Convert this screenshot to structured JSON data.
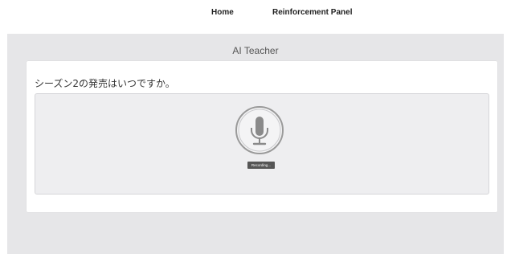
{
  "nav": {
    "home_label": "Home",
    "reinforcement_label": "Reinforcement Panel"
  },
  "app": {
    "title": "AI Teacher",
    "question": "シーズン2の発売はいつですか。",
    "mic_icon": "microphone-icon",
    "recording_status": "Recording..."
  },
  "colors": {
    "page_background": "#ffffff",
    "app_background": "#e6e6e8",
    "card_background": "#ffffff",
    "record_panel_background": "#eeeef0",
    "mic_gray": "#8a8a8a",
    "badge_background": "#555555"
  }
}
